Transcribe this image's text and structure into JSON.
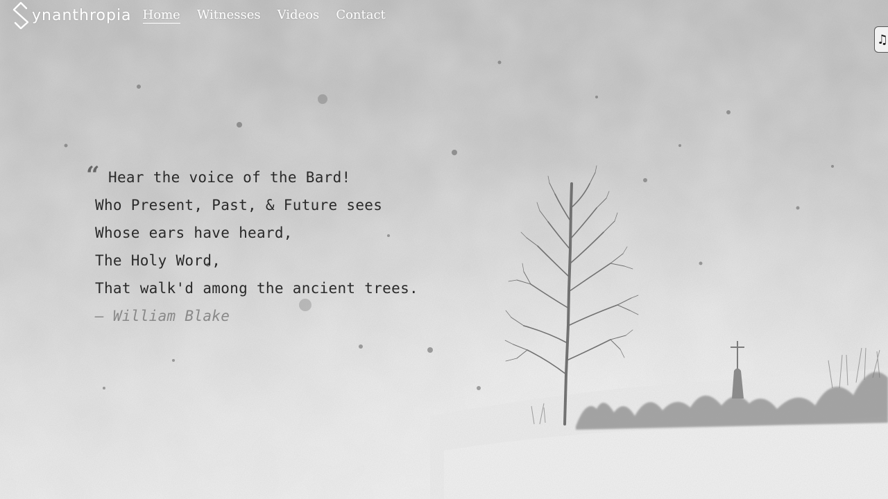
{
  "brand": {
    "name": "ynanthropia"
  },
  "nav": {
    "items": [
      {
        "label": "Home",
        "active": true
      },
      {
        "label": "Witnesses",
        "active": false
      },
      {
        "label": "Videos",
        "active": false
      },
      {
        "label": "Contact",
        "active": false
      }
    ]
  },
  "music_button": {
    "icon": "music-note-icon",
    "glyph": "♫"
  },
  "quote": {
    "lines": [
      "Hear the voice of the Bard!",
      "Who Present, Past, & Future sees",
      "Whose ears have heard,",
      "The Holy Word,",
      "That walk'd among the ancient trees."
    ],
    "attribution": "— William Blake"
  }
}
